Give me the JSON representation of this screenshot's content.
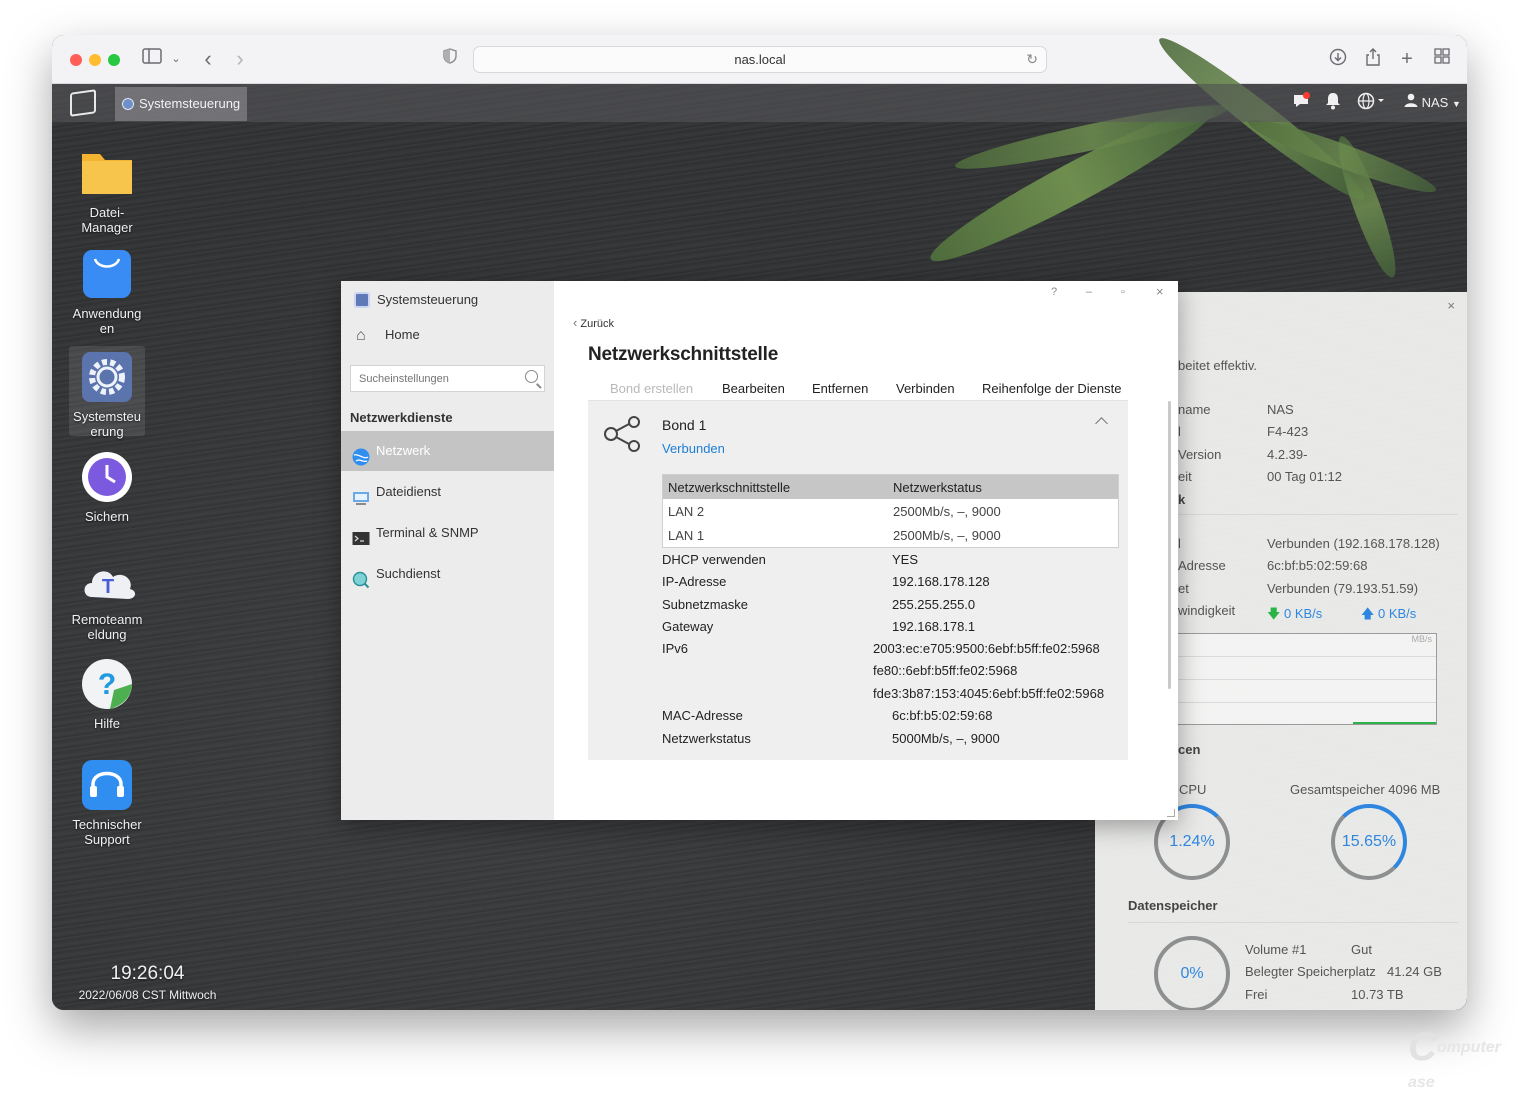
{
  "browser": {
    "url": "nas.local",
    "colors": {
      "close": "#ff5f57",
      "minimize": "#febc2e",
      "zoom": "#28c840"
    },
    "icons": [
      "sidebar-icon",
      "chevron-down-icon",
      "back-icon",
      "forward-icon",
      "shield-icon",
      "reload-icon",
      "download-icon",
      "share-icon",
      "new-tab-icon",
      "tab-overview-icon"
    ]
  },
  "taskbar": {
    "active_app": "Systemsteuerung",
    "user": "NAS"
  },
  "desktop": {
    "icons": [
      {
        "label": "Datei-\nManager"
      },
      {
        "label": "Anwendung\nen"
      },
      {
        "label": "Systemsteu\nerung"
      },
      {
        "label": "Sichern"
      },
      {
        "label": "Remoteanm\neldung"
      },
      {
        "label": "Hilfe"
      },
      {
        "label": "Technischer\nSupport"
      }
    ],
    "clock": {
      "time": "19:26:04",
      "date": "2022/06/08 CST Mittwoch"
    }
  },
  "widget": {
    "intro": "beitet effektiv.",
    "system": [
      {
        "key": "name",
        "value": "NAS"
      },
      {
        "key": "l",
        "value": "F4-423"
      },
      {
        "key": "Version",
        "value": "4.2.39-"
      },
      {
        "key": "eit",
        "value": "00 Tag 01:12"
      }
    ],
    "network_heading": "k",
    "network": [
      {
        "key": "l",
        "value": "Verbunden (192.168.178.128)"
      },
      {
        "key": "Adresse",
        "value": "6c:bf:b5:02:59:68"
      },
      {
        "key": "et",
        "value": "Verbunden (79.193.51.59)"
      },
      {
        "key": "windigkeit",
        "value": ""
      }
    ],
    "speed_down": "0 KB/s",
    "speed_up": "0 KB/s",
    "chart_unit": "MB/s",
    "resources_heading": "cen",
    "cpu_label": "CPU",
    "cpu_value": "1.24%",
    "mem_label": "Gesamtspeicher 4096 MB",
    "mem_value": "15.65%",
    "storage_heading": "Datenspeicher",
    "storage_value": "0%",
    "volume_name": "Volume #1",
    "volume_status": "Gut",
    "used_label": "Belegter Speicherplatz",
    "used_value": "41.24 GB",
    "free_label": "Frei",
    "free_value": "10.73 TB"
  },
  "window": {
    "app_title": "Systemsteuerung",
    "home": "Home",
    "search_placeholder": "Sucheinstellungen",
    "section": "Netzwerkdienste",
    "nav": [
      "Netzwerk",
      "Dateidienst",
      "Terminal & SNMP",
      "Suchdienst"
    ],
    "controls": {
      "help": "?",
      "minimize": "–",
      "maximize": "▫",
      "close": "×"
    },
    "back": "Zurück",
    "title": "Netzwerkschnittstelle",
    "actions": {
      "create_bond": "Bond erstellen",
      "edit": "Bearbeiten",
      "remove": "Entfernen",
      "connect": "Verbinden",
      "order": "Reihenfolge der Dienste"
    },
    "bond": {
      "name": "Bond 1",
      "status": "Verbunden"
    },
    "table": {
      "headers": [
        "Netzwerkschnittstelle",
        "Netzwerkstatus"
      ],
      "rows": [
        [
          "LAN 2",
          "2500Mb/s, –, 9000"
        ],
        [
          "LAN 1",
          "2500Mb/s, –, 9000"
        ]
      ]
    },
    "details": {
      "dhcp_key": "DHCP verwenden",
      "dhcp": "YES",
      "ip_key": "IP-Adresse",
      "ip": "192.168.178.128",
      "mask_key": "Subnetzmaske",
      "mask": "255.255.255.0",
      "gw_key": "Gateway",
      "gw": "192.168.178.1",
      "ipv6_key": "IPv6",
      "ipv6": [
        "2003:ec:e705:9500:6ebf:b5ff:fe02:5968",
        "fe80::6ebf:b5ff:fe02:5968",
        "fde3:3b87:153:4045:6ebf:b5ff:fe02:5968"
      ],
      "mac_key": "MAC-Adresse",
      "mac": "6c:bf:b5:02:59:68",
      "status_key": "Netzwerkstatus",
      "status": "5000Mb/s, –, 9000"
    }
  },
  "watermark": "omputer ase"
}
